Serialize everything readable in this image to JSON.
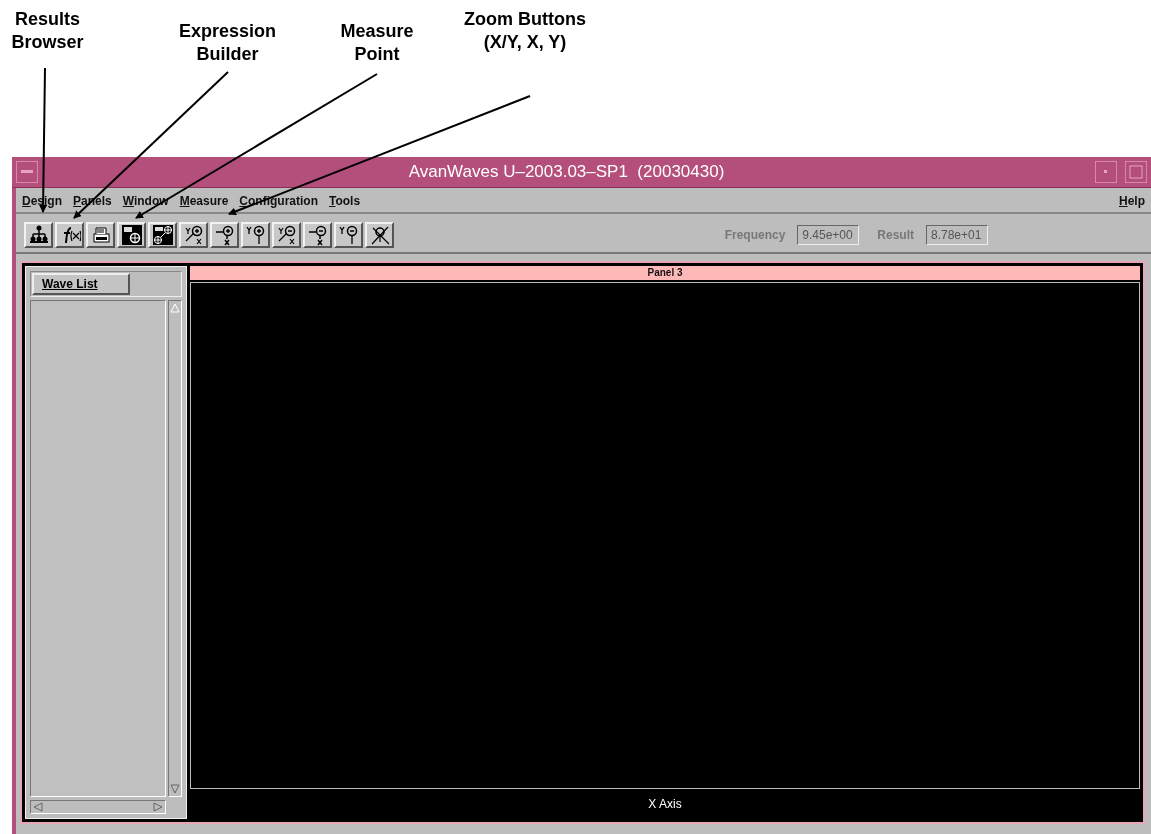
{
  "callouts": [
    {
      "label": "Results Browser"
    },
    {
      "label": "Expression Builder"
    },
    {
      "label": "Measure Point"
    },
    {
      "label": "Zoom Buttons (X/Y, X, Y)"
    }
  ],
  "window": {
    "title": "AvanWaves U–2003.03–SP1  (20030430)"
  },
  "menu": [
    "Design",
    "Panels",
    "Window",
    "Measure",
    "Configuration",
    "Tools"
  ],
  "help_menu": "Help",
  "toolbar": [
    {
      "kind": "hierarchy",
      "pressed": false
    },
    {
      "kind": "function",
      "pressed": false
    },
    {
      "kind": "printer",
      "pressed": false
    },
    {
      "kind": "measure",
      "pressed": false
    },
    {
      "kind": "measure2",
      "pressed": false
    },
    {
      "kind": "zoom_xy_in",
      "pressed": false
    },
    {
      "kind": "zoom_x_in",
      "pressed": false
    },
    {
      "kind": "zoom_y_in",
      "pressed": false
    },
    {
      "kind": "zoom_xy_out",
      "pressed": false
    },
    {
      "kind": "zoom_x_out",
      "pressed": false
    },
    {
      "kind": "zoom_y_out",
      "pressed": false
    },
    {
      "kind": "zoom_fit",
      "pressed": false
    }
  ],
  "readouts": [
    {
      "label": "Frequency",
      "value": "9.45e+00"
    },
    {
      "label": "Result",
      "value": "8.78e+01"
    }
  ],
  "wave_list": {
    "button": "Wave List"
  },
  "panel": {
    "title": "Panel 3",
    "x_axis": "X Axis"
  }
}
